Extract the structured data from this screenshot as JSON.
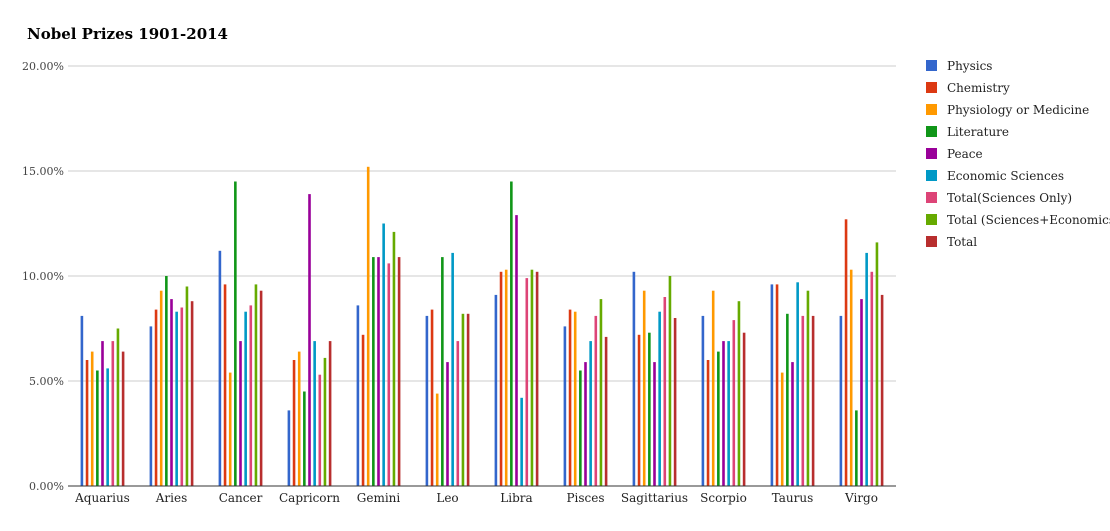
{
  "chart_data": {
    "type": "bar",
    "title": "Nobel Prizes 1901-2014",
    "xlabel": "",
    "ylabel": "",
    "ylim": [
      0,
      20
    ],
    "yticks": [
      "0.00%",
      "5.00%",
      "10.00%",
      "15.00%",
      "20.00%"
    ],
    "legend_position": "right",
    "grid": true,
    "categories": [
      "Aquarius",
      "Aries",
      "Cancer",
      "Capricorn",
      "Gemini",
      "Leo",
      "Libra",
      "Pisces",
      "Sagittarius",
      "Scorpio",
      "Taurus",
      "Virgo"
    ],
    "series": [
      {
        "name": "Physics",
        "color": "#3366cc",
        "values": [
          8.1,
          7.6,
          11.2,
          3.6,
          8.6,
          8.1,
          9.1,
          7.6,
          10.2,
          8.1,
          9.6,
          8.1
        ]
      },
      {
        "name": "Chemistry",
        "color": "#dc3912",
        "values": [
          6.0,
          8.4,
          9.6,
          6.0,
          7.2,
          8.4,
          10.2,
          8.4,
          7.2,
          6.0,
          9.6,
          12.7
        ]
      },
      {
        "name": "Physiology or Medicine",
        "color": "#ff9900",
        "values": [
          6.4,
          9.3,
          5.4,
          6.4,
          15.2,
          4.4,
          10.3,
          8.3,
          9.3,
          9.3,
          5.4,
          10.3
        ]
      },
      {
        "name": "Literature",
        "color": "#109618",
        "values": [
          5.5,
          10.0,
          14.5,
          4.5,
          10.9,
          10.9,
          14.5,
          5.5,
          7.3,
          6.4,
          8.2,
          3.6
        ]
      },
      {
        "name": "Peace",
        "color": "#990099",
        "values": [
          6.9,
          8.9,
          6.9,
          13.9,
          10.9,
          5.9,
          12.9,
          5.9,
          5.9,
          6.9,
          5.9,
          8.9
        ]
      },
      {
        "name": "Economic Sciences",
        "color": "#0099c6",
        "values": [
          5.6,
          8.3,
          8.3,
          6.9,
          12.5,
          11.1,
          4.2,
          6.9,
          8.3,
          6.9,
          9.7,
          11.1
        ]
      },
      {
        "name": "Total(Sciences Only)",
        "color": "#dd4477",
        "values": [
          6.9,
          8.5,
          8.6,
          5.3,
          10.6,
          6.9,
          9.9,
          8.1,
          9.0,
          7.9,
          8.1,
          10.2
        ]
      },
      {
        "name": "Total (Sciences+Economics)",
        "color": "#66aa00",
        "values": [
          7.5,
          9.5,
          9.6,
          6.1,
          12.1,
          8.2,
          10.3,
          8.9,
          10.0,
          8.8,
          9.3,
          11.6
        ]
      },
      {
        "name": "Total",
        "color": "#b82e2e",
        "values": [
          6.4,
          8.8,
          9.3,
          6.9,
          10.9,
          8.2,
          10.2,
          7.1,
          8.0,
          7.3,
          8.1,
          9.1
        ]
      }
    ]
  }
}
